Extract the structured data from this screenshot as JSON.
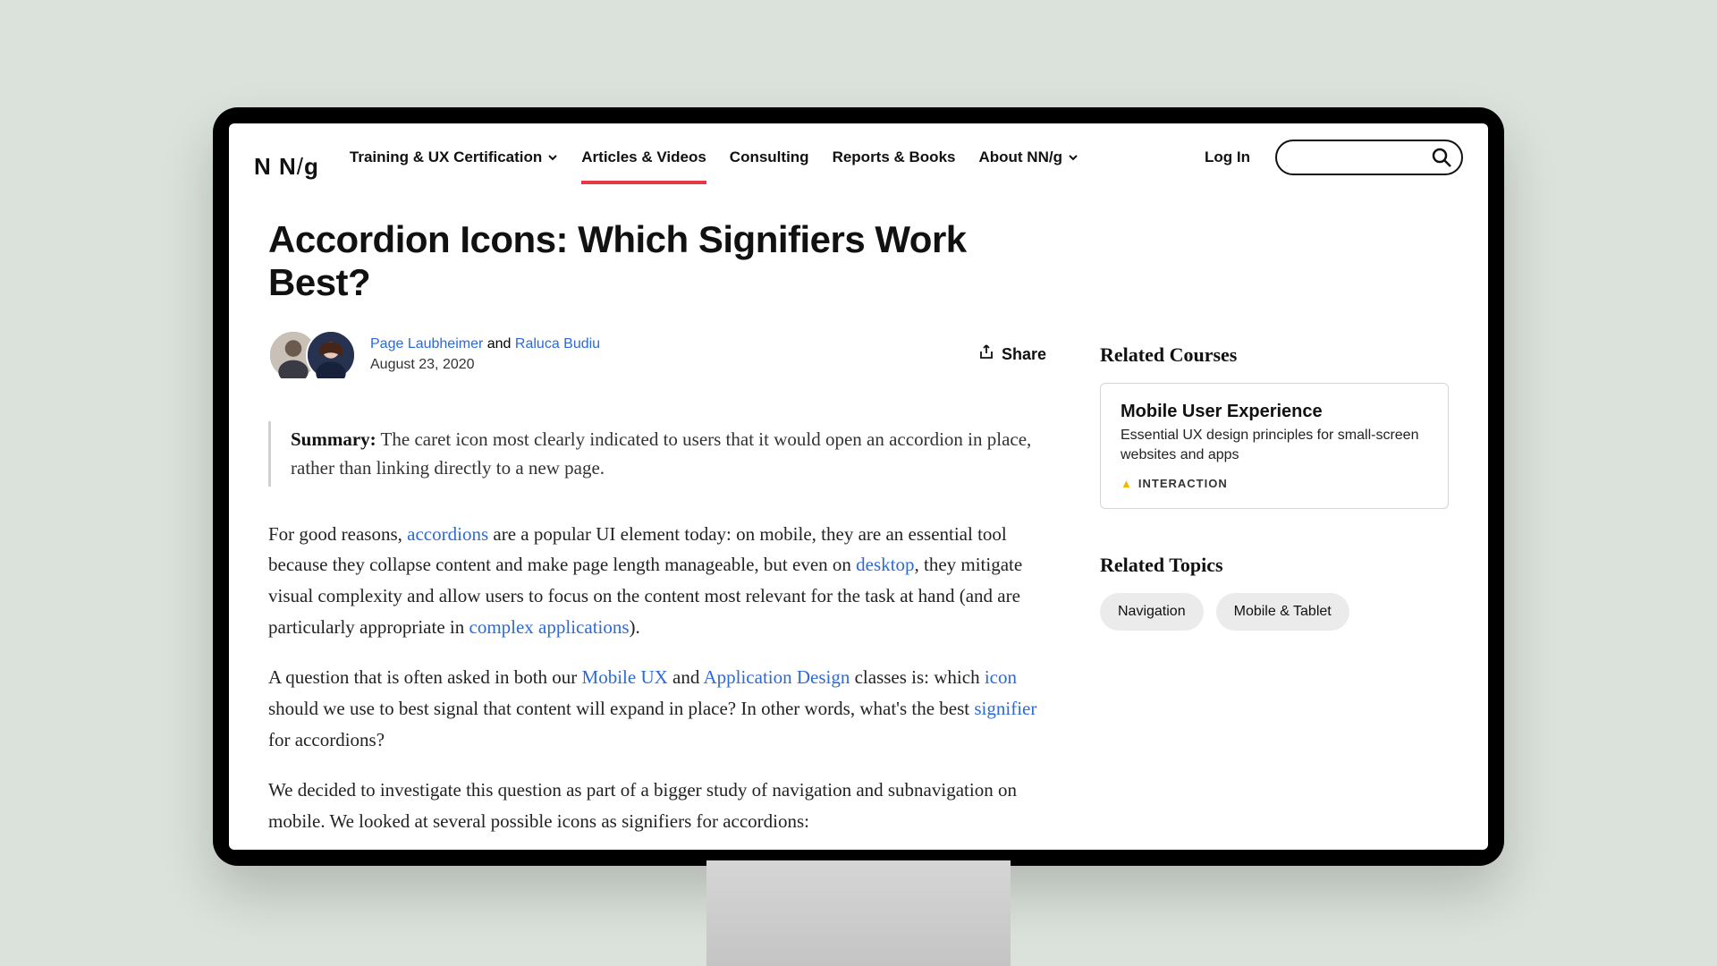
{
  "logo": "NN/g",
  "nav": {
    "training": "Training & UX Certification",
    "active": "Articles & Videos",
    "consulting": "Consulting",
    "reports": "Reports & Books",
    "about": "About NN/g"
  },
  "login": "Log In",
  "article": {
    "title": "Accordion Icons: Which Signifiers Work Best?",
    "author1": "Page Laubheimer",
    "authorJoin": " and ",
    "author2": "Raluca Budiu",
    "date": "August 23, 2020",
    "share": "Share",
    "summaryLabel": "Summary:",
    "summaryText": " The caret icon most clearly indicated to users that it would open an accordion in place, rather than linking directly to a new page.",
    "p1a": "For good reasons, ",
    "p1_link1": "accordions",
    "p1b": " are a popular UI element today: on mobile, they are an essential tool because they collapse content and make page length manageable, but even on ",
    "p1_link2": "desktop",
    "p1c": ", they mitigate visual complexity and allow users to focus on the content most relevant for the task at hand (and are particularly appropriate in ",
    "p1_link3": "complex applications",
    "p1d": ").",
    "p2a": "A question that is often asked in both our ",
    "p2_link1": "Mobile UX",
    "p2b": " and ",
    "p2_link2": "Application Design",
    "p2c": " classes is: which ",
    "p2_link3": "icon",
    "p2d": " should we use to best signal that content will expand in place? In other words, what's the best ",
    "p2_link4": "signifier",
    "p2e": " for accordions?",
    "p3": "We decided to investigate this question as part of a bigger study of navigation and subnavigation on mobile. We looked at several possible icons as signifiers for accordions:"
  },
  "sidebar": {
    "coursesHeading": "Related Courses",
    "course": {
      "title": "Mobile User Experience",
      "desc": "Essential UX design principles for small-screen websites and apps",
      "tag": "INTERACTION"
    },
    "topicsHeading": "Related Topics",
    "topics": [
      "Navigation",
      "Mobile & Tablet"
    ]
  }
}
